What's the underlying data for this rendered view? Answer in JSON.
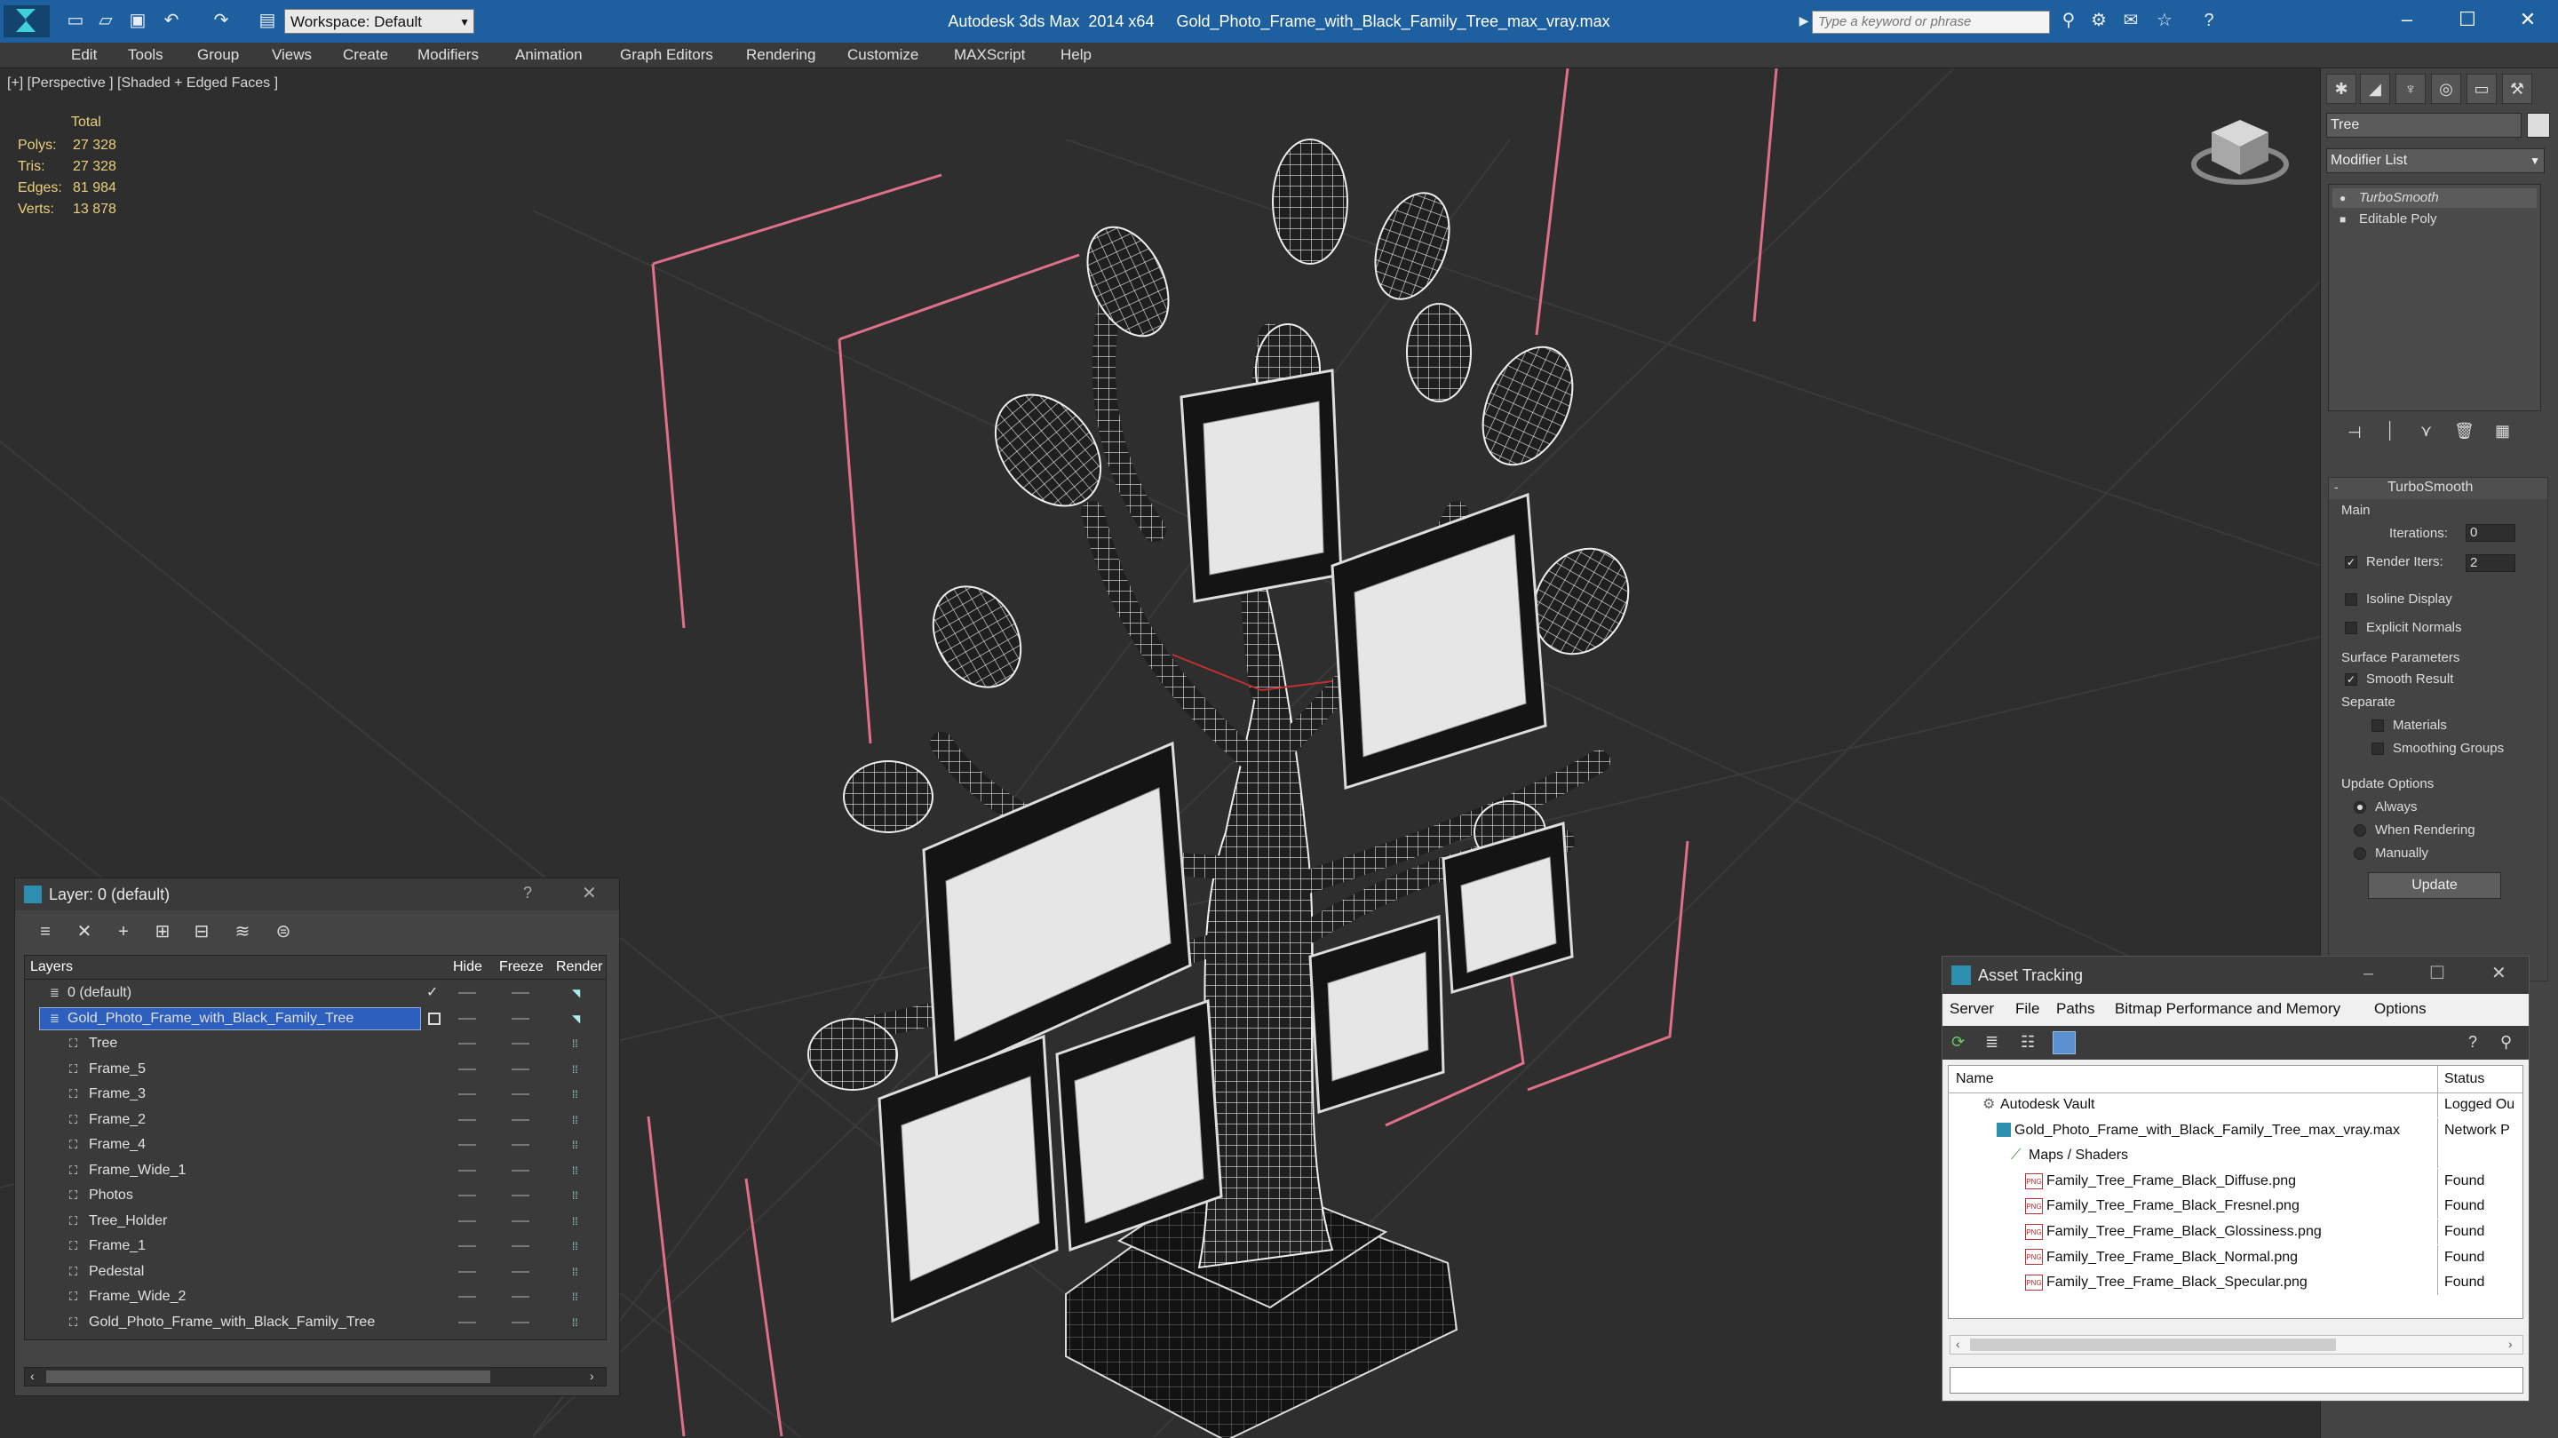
{
  "app": {
    "title": "Autodesk 3ds Max  2014 x64     Gold_Photo_Frame_with_Black_Family_Tree_max_vray.max",
    "workspace": "Workspace: Default",
    "search_placeholder": "Type a keyword or phrase"
  },
  "menu": [
    "Edit",
    "Tools",
    "Group",
    "Views",
    "Create",
    "Modifiers",
    "Animation",
    "Graph Editors",
    "Rendering",
    "Customize",
    "MAXScript",
    "Help"
  ],
  "viewport": {
    "label": "[+] [Perspective ] [Shaded + Edged Faces ]",
    "stats": {
      "header": "Total",
      "rows": [
        {
          "label": "Polys:",
          "value": "27 328"
        },
        {
          "label": "Tris:",
          "value": "27 328"
        },
        {
          "label": "Edges:",
          "value": "81 984"
        },
        {
          "label": "Verts:",
          "value": "13 878"
        }
      ]
    }
  },
  "command_panel": {
    "object_name": "Tree",
    "modifier_list": "Modifier List",
    "stack": [
      "TurboSmooth",
      "Editable Poly"
    ],
    "rollout_title": "TurboSmooth",
    "main_label": "Main",
    "iterations_label": "Iterations:",
    "iterations_value": "0",
    "render_iters_label": "Render Iters:",
    "render_iters_value": "2",
    "isoline_label": "Isoline Display",
    "explicit_normals_label": "Explicit Normals",
    "surface_params_label": "Surface Parameters",
    "smooth_result_label": "Smooth Result",
    "separate_label": "Separate",
    "materials_label": "Materials",
    "smoothing_groups_label": "Smoothing Groups",
    "update_options_label": "Update Options",
    "always_label": "Always",
    "when_rendering_label": "When Rendering",
    "manually_label": "Manually",
    "update_button": "Update"
  },
  "layer_dialog": {
    "title": "Layer: 0 (default)",
    "help": "?",
    "columns": {
      "layers": "Layers",
      "hide": "Hide",
      "freeze": "Freeze",
      "render": "Render"
    },
    "rows": [
      {
        "name": "0 (default)",
        "level": 0
      },
      {
        "name": "Gold_Photo_Frame_with_Black_Family_Tree",
        "level": 0,
        "selected": true
      },
      {
        "name": "Tree",
        "level": 1
      },
      {
        "name": "Frame_5",
        "level": 1
      },
      {
        "name": "Frame_3",
        "level": 1
      },
      {
        "name": "Frame_2",
        "level": 1
      },
      {
        "name": "Frame_4",
        "level": 1
      },
      {
        "name": "Frame_Wide_1",
        "level": 1
      },
      {
        "name": "Photos",
        "level": 1
      },
      {
        "name": "Tree_Holder",
        "level": 1
      },
      {
        "name": "Frame_1",
        "level": 1
      },
      {
        "name": "Pedestal",
        "level": 1
      },
      {
        "name": "Frame_Wide_2",
        "level": 1
      },
      {
        "name": "Gold_Photo_Frame_with_Black_Family_Tree",
        "level": 1
      }
    ]
  },
  "asset_tracking": {
    "title": "Asset Tracking",
    "menu": [
      "Server",
      "File",
      "Paths",
      "Bitmap Performance and Memory",
      "Options"
    ],
    "columns": {
      "name": "Name",
      "status": "Status"
    },
    "rows": [
      {
        "name": "Autodesk Vault",
        "status": "Logged Ou",
        "level": 1,
        "icon": "vault-icon"
      },
      {
        "name": "Gold_Photo_Frame_with_Black_Family_Tree_max_vray.max",
        "status": "Network P",
        "level": 2,
        "icon": "max-file-icon"
      },
      {
        "name": "Maps / Shaders",
        "status": "",
        "level": 3,
        "icon": "maps-icon"
      },
      {
        "name": "Family_Tree_Frame_Black_Diffuse.png",
        "status": "Found",
        "level": 4,
        "icon": "png-icon"
      },
      {
        "name": "Family_Tree_Frame_Black_Fresnel.png",
        "status": "Found",
        "level": 4,
        "icon": "png-icon"
      },
      {
        "name": "Family_Tree_Frame_Black_Glossiness.png",
        "status": "Found",
        "level": 4,
        "icon": "png-icon"
      },
      {
        "name": "Family_Tree_Frame_Black_Normal.png",
        "status": "Found",
        "level": 4,
        "icon": "png-icon"
      },
      {
        "name": "Family_Tree_Frame_Black_Specular.png",
        "status": "Found",
        "level": 4,
        "icon": "png-icon"
      }
    ]
  },
  "colors": {
    "title_bar": "#1e5f9f",
    "selection": "#2d5fbf",
    "stats": "#e8d07a",
    "gizmo_pink": "#e0708a"
  }
}
